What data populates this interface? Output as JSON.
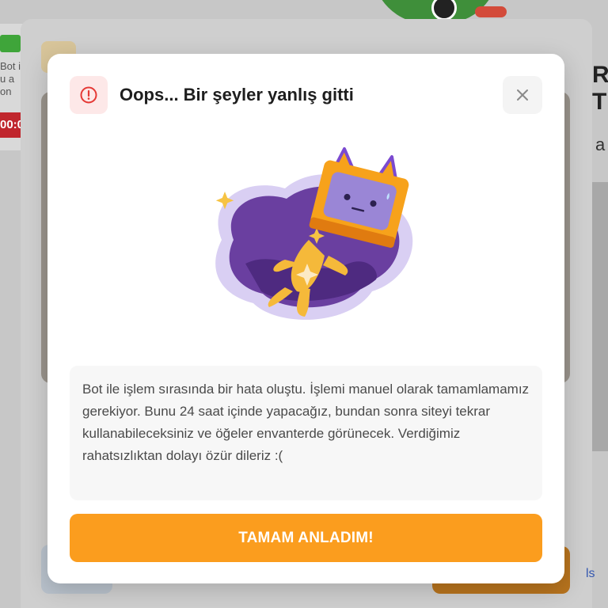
{
  "background": {
    "left_text": "Bot i u a on",
    "left_timer": "00:0",
    "right_title": "R T",
    "right_sub": "a",
    "right_link": "ls"
  },
  "modal": {
    "title": "Oops... Bir şeyler yanlış gitti",
    "alert_icon": "exclamation-circle-icon",
    "close_icon": "close-icon",
    "illustration": "cat-robot-illustration",
    "message": "Bot ile işlem sırasında bir hata oluştu. İşlemi manuel olarak tamamlamamız gerekiyor. Bunu 24 saat içinde yapacağız, bundan sonra siteyi tekrar kullanabileceksiniz ve öğeler envanterde görünecek. Verdiğimiz rahatsızlıktan dolayı özür dileriz :(",
    "confirm_label": "TAMAM ANLADIM!"
  },
  "colors": {
    "accent": "#fb9d1e",
    "alert": "#e53935",
    "alert_bg": "#fde8e8"
  }
}
